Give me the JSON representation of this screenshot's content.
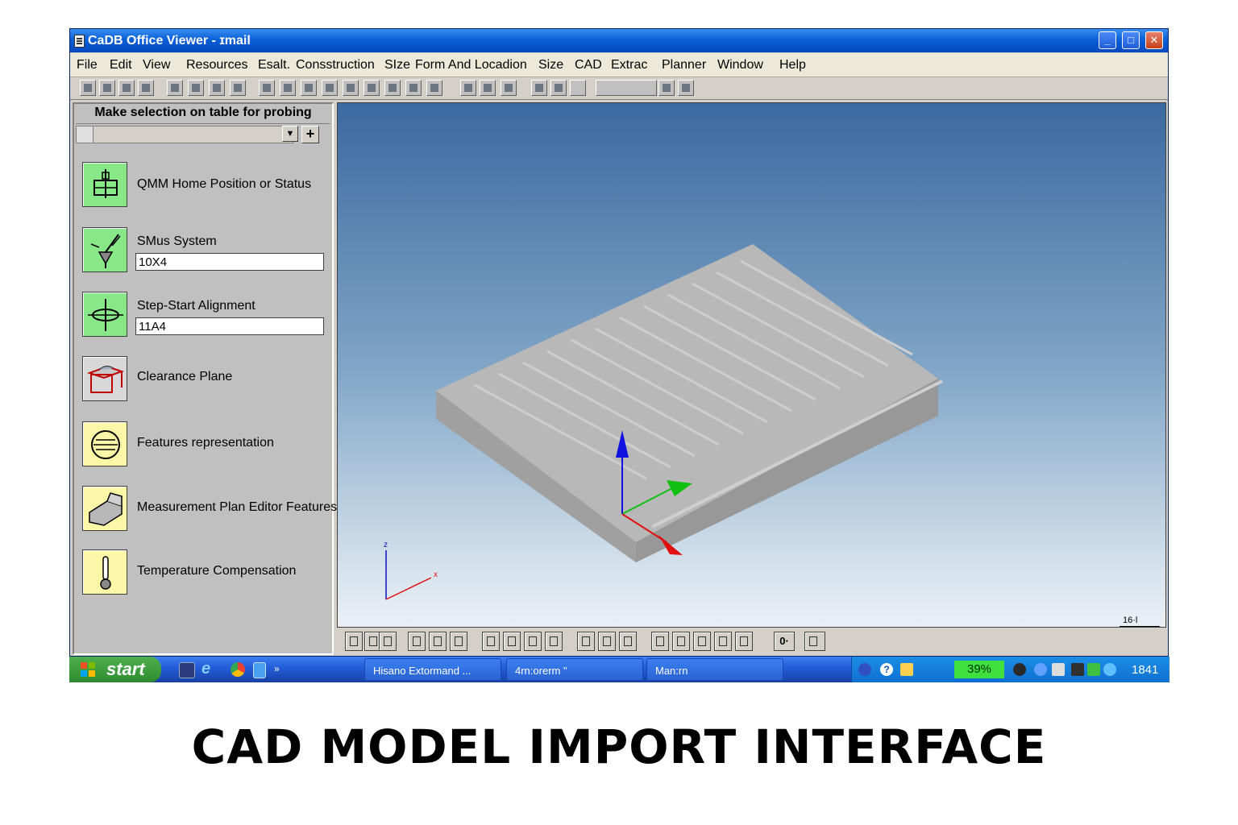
{
  "window": {
    "title": "CaDB Office Viewer - ɪmail",
    "buttons": {
      "minimize": "_",
      "maximize": "□",
      "close": "✕"
    }
  },
  "menu": {
    "items": [
      "File",
      "Edit",
      "View",
      "Resources",
      "Esalt.",
      "Consstruction",
      "SIze",
      "Form And Locadion",
      "Size",
      "CAD",
      "Extrac",
      "Planner",
      "Window",
      "Help"
    ]
  },
  "panel": {
    "title": "Make selection on table for probing",
    "add_button": "+",
    "dropdown_arrow": "▼",
    "items": [
      {
        "label": "QMM Home Position or Status",
        "icon": "home-position-icon",
        "color": "#88e888"
      },
      {
        "label": "SMus System",
        "value": "10X4",
        "icon": "probe-system-icon",
        "color": "#88e888"
      },
      {
        "label": "Step-Start Alignment",
        "value": "11A4",
        "icon": "alignment-icon",
        "color": "#88e888"
      },
      {
        "label": "Clearance Plane",
        "icon": "clearance-plane-icon",
        "color": "#d8d8d8"
      },
      {
        "label": "Features representation",
        "icon": "features-icon",
        "color": "#fcf8a8"
      },
      {
        "label": "Measurement Plan Editor Features",
        "icon": "plan-editor-icon",
        "color": "#fcf8a8"
      },
      {
        "label": "Temperature Compensation",
        "icon": "thermometer-icon",
        "color": "#fcf8a8"
      }
    ]
  },
  "viewport": {
    "triad_labels": {
      "z": "z",
      "x": "x"
    },
    "scale_label": "16·l",
    "colors": {
      "axis_z": "#1010e0",
      "axis_y": "#10c010",
      "axis_x": "#e01010",
      "model": "#b4b4b4"
    }
  },
  "bottom_toolbar": {
    "zoom_value": "0·"
  },
  "taskbar": {
    "start_label": "start",
    "quick_launch_more": "»",
    "tasks": [
      "Hisano Extormand ...",
      "4rn:orerm \"",
      "Man:rn"
    ],
    "progress_text": "39%",
    "clock": "1841"
  },
  "caption": "CAD MODEL IMPORT INTERFACE"
}
